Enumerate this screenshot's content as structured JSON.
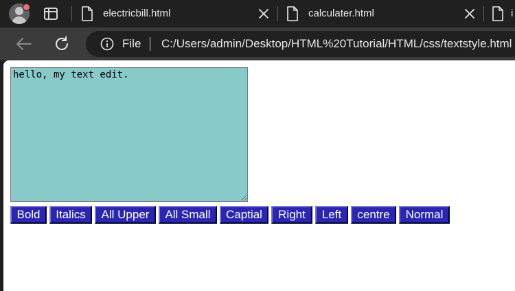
{
  "browser": {
    "tabs": [
      {
        "title": "electricbill.html"
      },
      {
        "title": "calculater.html"
      },
      {
        "title": "i"
      }
    ],
    "address": {
      "scheme": "File",
      "url": "C:/Users/admin/Desktop/HTML%20Tutorial/HTML/css/textstyle.html"
    }
  },
  "page": {
    "textarea_value": "hello, my text edit.",
    "buttons": {
      "bold": "Bold",
      "italics": "Italics",
      "all_upper": "All Upper",
      "all_small": "All Small",
      "captial": "Captial",
      "right": "Right",
      "left": "Left",
      "centre": "centre",
      "normal": "Normal"
    }
  },
  "colors": {
    "textarea_bg": "#88c9ca",
    "button_bg": "#2a26b0",
    "button_text": "#ffffff",
    "chrome_dark": "#202020",
    "toolbar_bg": "#3b3b3b"
  },
  "icons": [
    "profile-avatar-icon",
    "tab-search-icon",
    "file-icon",
    "close-icon",
    "back-arrow-icon",
    "reload-icon",
    "info-icon"
  ]
}
